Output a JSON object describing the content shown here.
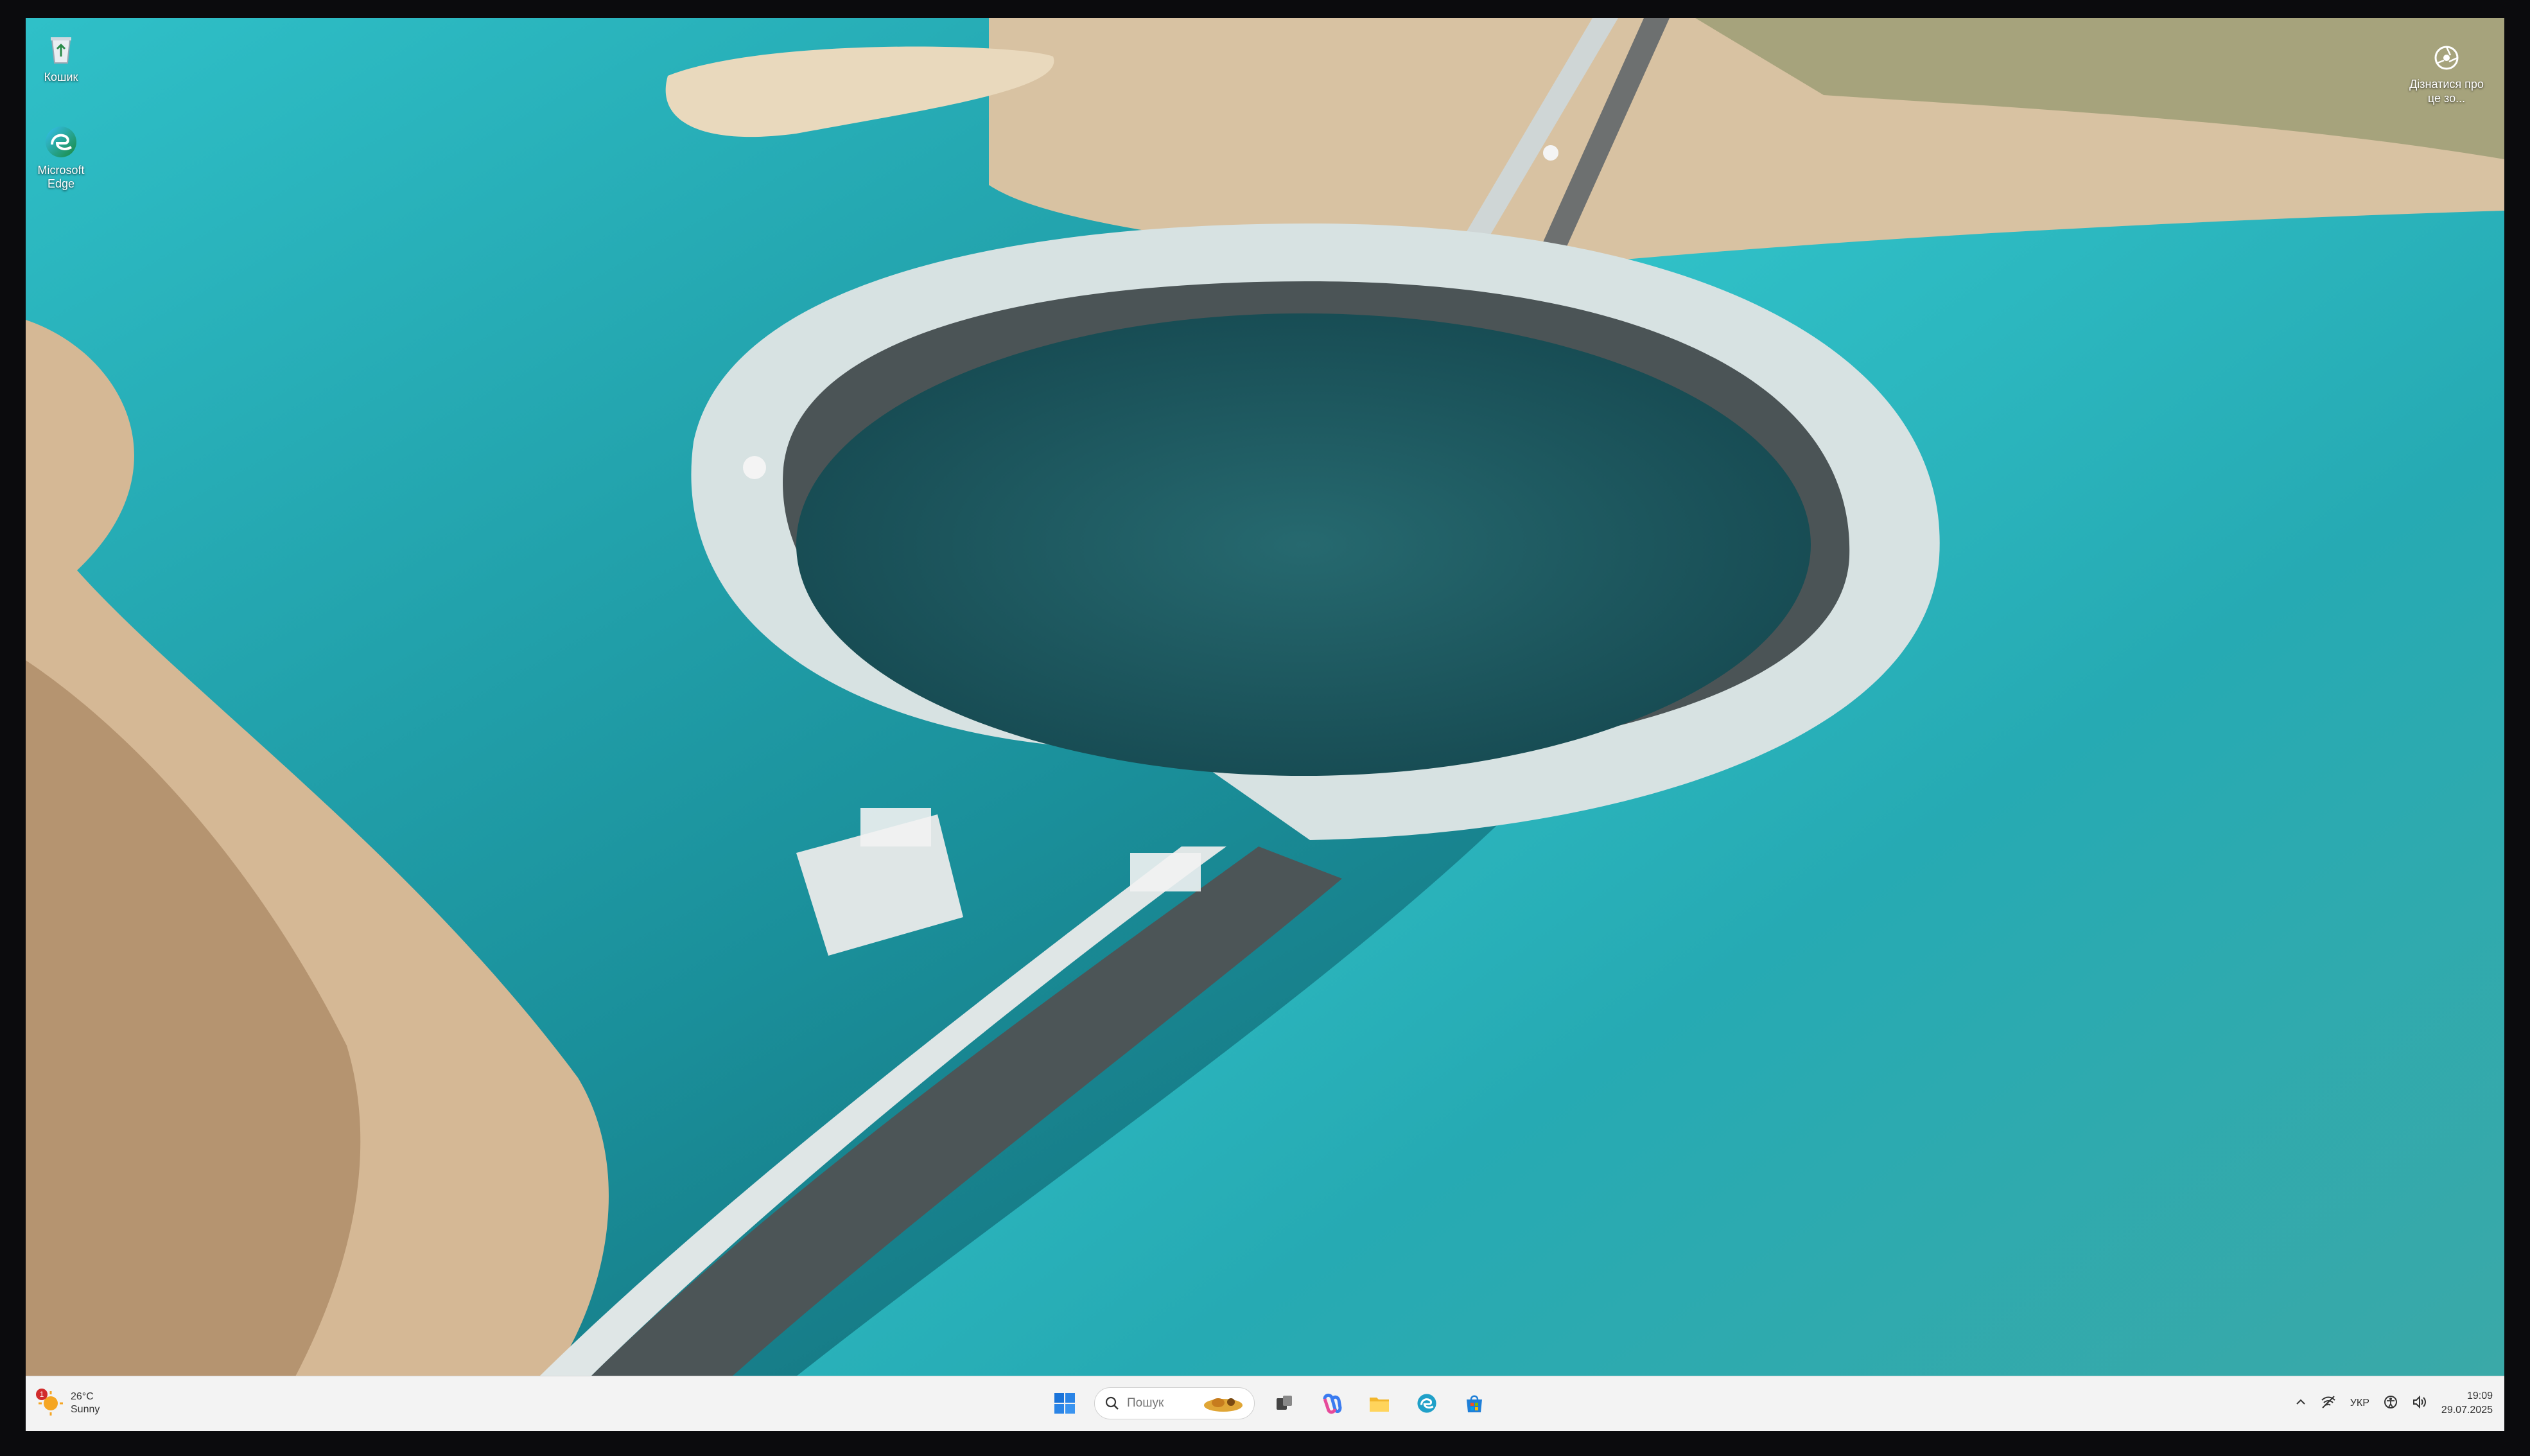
{
  "desktop": {
    "icons": [
      {
        "label": "Кошик",
        "icon": "recycle-bin-icon"
      },
      {
        "label": "Microsoft Edge",
        "icon": "edge-icon"
      }
    ],
    "widget": {
      "label": "Дізнатися про це зо...",
      "icon": "lens-icon"
    }
  },
  "taskbar": {
    "weather": {
      "temp": "26°C",
      "condition": "Sunny",
      "badge": "1"
    },
    "search": {
      "placeholder": "Пошук"
    },
    "pinned_icons": [
      "start-icon",
      "search-icon",
      "task-view-icon",
      "copilot-icon",
      "file-explorer-icon",
      "edge-icon",
      "store-icon"
    ],
    "tray": {
      "language": "УКР",
      "time": "19:09",
      "date": "29.07.2025"
    }
  },
  "colors": {
    "taskbar_bg": "#f3f3f3",
    "water": "#1aa3ad",
    "sand": "#d9c2a3"
  }
}
